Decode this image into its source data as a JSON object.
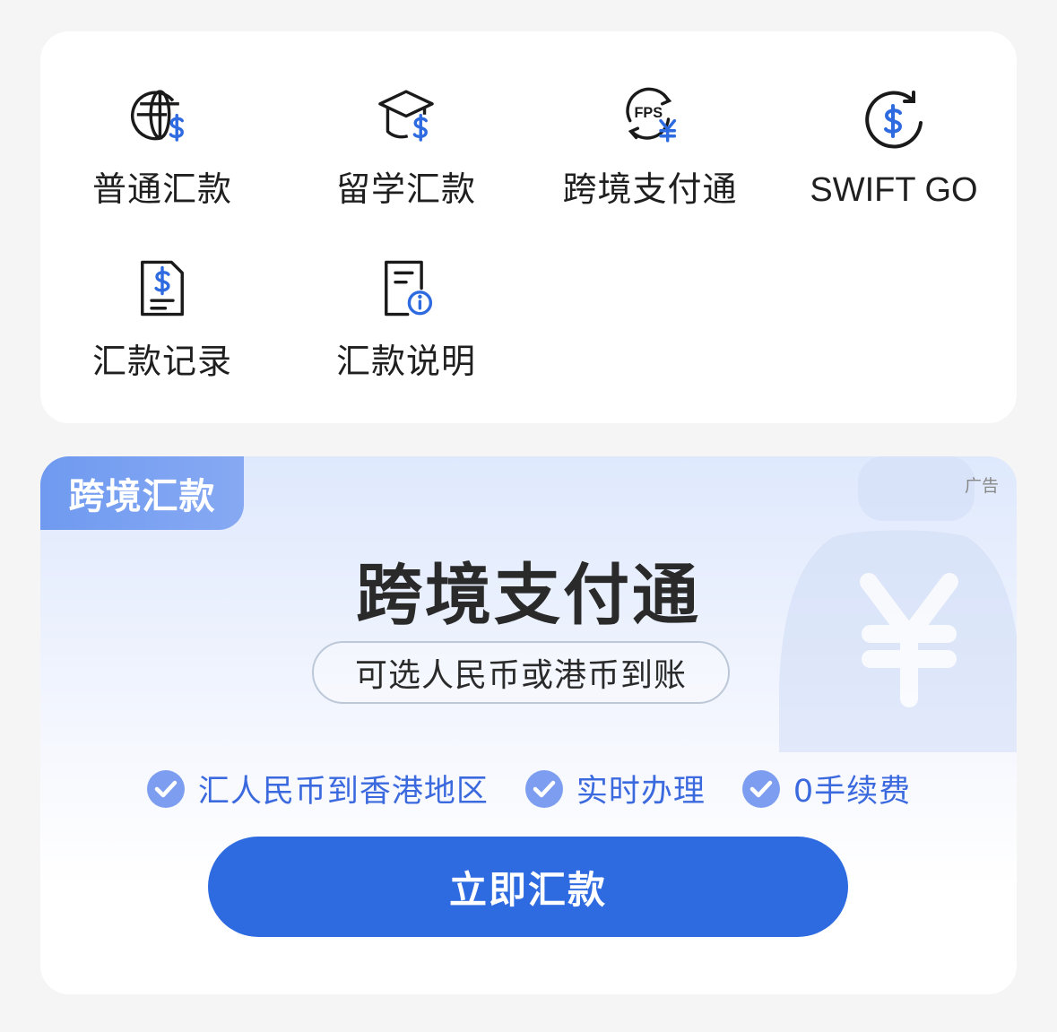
{
  "menu": {
    "items": [
      {
        "label": "普通汇款",
        "icon": "globe-dollar-icon"
      },
      {
        "label": "留学汇款",
        "icon": "graduation-cap-dollar-icon"
      },
      {
        "label": "跨境支付通",
        "icon": "fps-yuan-icon"
      },
      {
        "label": "SWIFT GO",
        "icon": "circular-dollar-icon"
      },
      {
        "label": "汇款记录",
        "icon": "dollar-document-icon"
      },
      {
        "label": "汇款说明",
        "icon": "info-document-icon"
      }
    ],
    "fps_badge": "FPS"
  },
  "promo": {
    "tag": "跨境汇款",
    "ad_label": "广告",
    "title": "跨境支付通",
    "subtitle": "可选人民币或港币到账",
    "features": [
      "汇人民币到香港地区",
      "实时办理",
      "0手续费"
    ],
    "cta_label": "立即汇款"
  },
  "colors": {
    "accent": "#2f6be0",
    "icon_blue": "#2f6be0",
    "feature_text": "#3b69de",
    "tag_start": "#6f9af0",
    "background": "#f5f5f5"
  }
}
